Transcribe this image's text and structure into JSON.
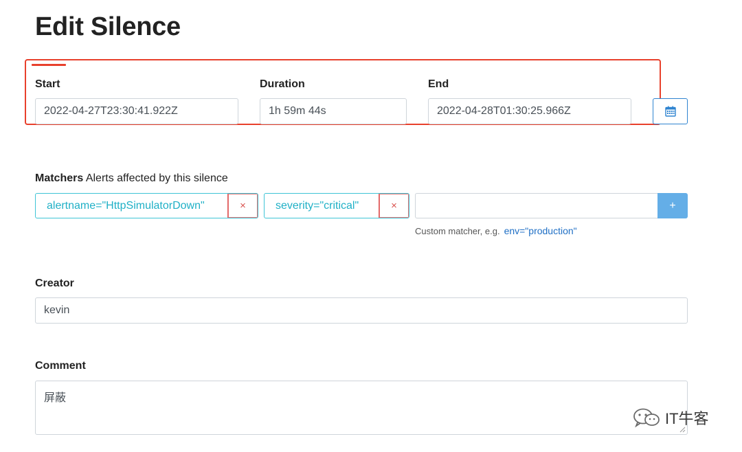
{
  "page": {
    "title": "Edit Silence"
  },
  "time": {
    "start_label": "Start",
    "start_value": "2022-04-27T23:30:41.922Z",
    "duration_label": "Duration",
    "duration_value": "1h 59m 44s",
    "end_label": "End",
    "end_value": "2022-04-28T01:30:25.966Z"
  },
  "matchers": {
    "heading_bold": "Matchers",
    "heading_rest": " Alerts affected by this silence",
    "items": [
      {
        "text": "alertname=\"HttpSimulatorDown\"",
        "remove": "×"
      },
      {
        "text": "severity=\"critical\"",
        "remove": "×"
      }
    ],
    "add_label": "+",
    "hint_prefix": "Custom matcher, e.g.",
    "hint_example": "env=\"production\""
  },
  "creator": {
    "label": "Creator",
    "value": "kevin"
  },
  "comment": {
    "label": "Comment",
    "value": "屏蔽"
  },
  "watermark": {
    "text": "IT牛客",
    "icon": "wechat-icon"
  },
  "colors": {
    "highlight_frame": "#e8402c",
    "chip_border": "#3ec4d6",
    "remove_red": "#d9534f",
    "add_button": "#64aee7",
    "calendar_blue": "#2e83d0"
  }
}
